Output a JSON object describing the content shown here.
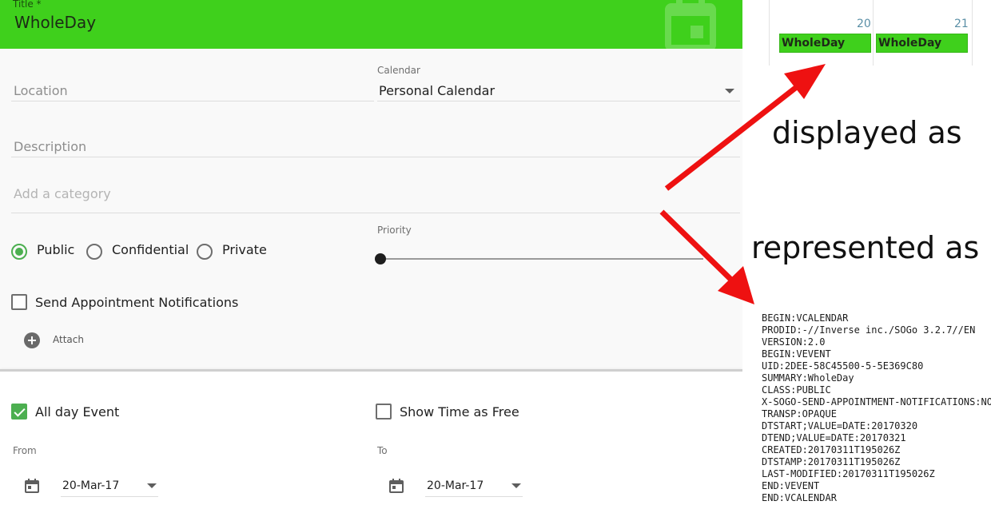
{
  "editor": {
    "title_label": "Title *",
    "title_value": "WholeDay",
    "location_placeholder": "Location",
    "calendar_label": "Calendar",
    "calendar_value": "Personal Calendar",
    "description_placeholder": "Description",
    "category_placeholder": "Add a category",
    "classification": {
      "options": [
        "Public",
        "Confidential",
        "Private"
      ],
      "selected": "Public"
    },
    "priority_label": "Priority",
    "priority_value": 0,
    "send_notifications_label": "Send Appointment Notifications",
    "send_notifications_checked": false,
    "attach_label": "Attach",
    "all_day_label": "All day Event",
    "all_day_checked": true,
    "show_free_label": "Show Time as Free",
    "show_free_checked": false,
    "from_label": "From",
    "from_value": "20-Mar-17",
    "to_label": "To",
    "to_value": "20-Mar-17"
  },
  "preview": {
    "days": [
      {
        "number": "20",
        "event": "WholeDay"
      },
      {
        "number": "21",
        "event": "WholeDay"
      }
    ]
  },
  "captions": {
    "displayed": "displayed as",
    "represented": "represented as"
  },
  "ics_lines": [
    "BEGIN:VCALENDAR",
    "PRODID:-//Inverse inc./SOGo 3.2.7//EN",
    "VERSION:2.0",
    "BEGIN:VEVENT",
    "UID:2DEE-58C45500-5-5E369C80",
    "SUMMARY:WholeDay",
    "CLASS:PUBLIC",
    "X-SOGO-SEND-APPOINTMENT-NOTIFICATIONS:NO",
    "TRANSP:OPAQUE",
    "DTSTART;VALUE=DATE:20170320",
    "DTEND;VALUE=DATE:20170321",
    "CREATED:20170311T195026Z",
    "DTSTAMP:20170311T195026Z",
    "LAST-MODIFIED:20170311T195026Z",
    "END:VEVENT",
    "END:VCALENDAR"
  ],
  "colors": {
    "event_green": "#3fd01c",
    "accent_green": "#4caf50",
    "arrow_red": "#ee1111"
  },
  "icons": [
    "calendar-icon",
    "plus-circle-icon",
    "chevron-down-icon",
    "arrow-icon"
  ]
}
